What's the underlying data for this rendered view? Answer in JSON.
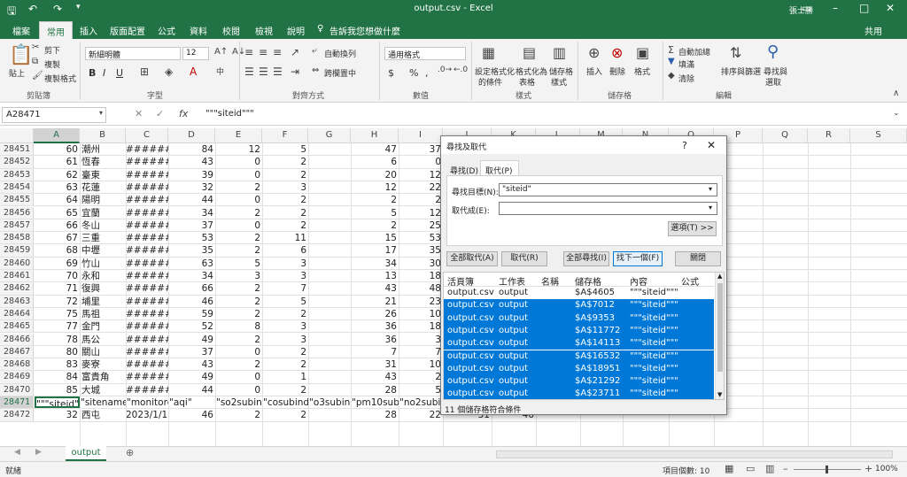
{
  "titlebar": {
    "file": "output.csv",
    "app": "Excel",
    "title": "output.csv - Excel",
    "user": "張士勝"
  },
  "tabs": [
    "檔案",
    "常用",
    "插入",
    "版面配置",
    "公式",
    "資料",
    "校閱",
    "檢視",
    "說明",
    "告訴我您想做什麼"
  ],
  "active_tab": "常用",
  "share": "共用",
  "ribbon": {
    "clipboard": {
      "paste": "貼上",
      "cut": "剪下",
      "copy": "複製",
      "format_painter": "複製格式",
      "label": "剪貼簿"
    },
    "font": {
      "name": "新細明體",
      "size": "12",
      "label": "字型",
      "bold": "B",
      "italic": "I",
      "underline": "U"
    },
    "alignment": {
      "wrap": "自動換列",
      "merge": "跨欄置中",
      "label": "對齊方式"
    },
    "number": {
      "format": "通用格式",
      "label": "數值",
      "currency": "$",
      "percent": "%",
      "comma": ","
    },
    "styles": {
      "conditional": [
        "設定格式化",
        "的條件"
      ],
      "table": [
        "格式化為",
        "表格"
      ],
      "cell": [
        "儲存格",
        "樣式"
      ],
      "label": "樣式"
    },
    "cells": {
      "insert": "插入",
      "delete": "刪除",
      "format": "格式",
      "label": "儲存格"
    },
    "editing": {
      "autosum": "自動加總",
      "fill": "填滿",
      "clear": "清除",
      "sort": [
        "排序與篩選"
      ],
      "find": [
        "尋找與",
        "選取"
      ],
      "label": "編輯"
    }
  },
  "formula_bar": {
    "name_box": "A28471",
    "content": "\"\"\"siteid\"\"\""
  },
  "columns": [
    "A",
    "B",
    "C",
    "D",
    "E",
    "F",
    "G",
    "H",
    "I",
    "J",
    "K",
    "L",
    "M",
    "N",
    "O",
    "P",
    "Q",
    "R",
    "S"
  ],
  "rows": [
    {
      "n": "28451",
      "a": "60",
      "b": "潮州",
      "c": "########",
      "d": "84",
      "e": "12",
      "f": "5",
      "h": "47",
      "i": "37"
    },
    {
      "n": "28452",
      "a": "61",
      "b": "恆春",
      "c": "########",
      "d": "43",
      "e": "0",
      "f": "2",
      "h": "6",
      "i": "0"
    },
    {
      "n": "28453",
      "a": "62",
      "b": "臺東",
      "c": "########",
      "d": "39",
      "e": "0",
      "f": "2",
      "h": "20",
      "i": "12"
    },
    {
      "n": "28454",
      "a": "63",
      "b": "花蓮",
      "c": "########",
      "d": "32",
      "e": "2",
      "f": "3",
      "h": "12",
      "i": "22"
    },
    {
      "n": "28455",
      "a": "64",
      "b": "陽明",
      "c": "########",
      "d": "44",
      "e": "0",
      "f": "2",
      "h": "2",
      "i": "2"
    },
    {
      "n": "28456",
      "a": "65",
      "b": "宜蘭",
      "c": "########",
      "d": "34",
      "e": "2",
      "f": "2",
      "h": "5",
      "i": "12"
    },
    {
      "n": "28457",
      "a": "66",
      "b": "冬山",
      "c": "########",
      "d": "37",
      "e": "0",
      "f": "2",
      "h": "2",
      "i": "25"
    },
    {
      "n": "28458",
      "a": "67",
      "b": "三重",
      "c": "########",
      "d": "53",
      "e": "2",
      "f": "11",
      "h": "15",
      "i": "53"
    },
    {
      "n": "28459",
      "a": "68",
      "b": "中壢",
      "c": "########",
      "d": "35",
      "e": "2",
      "f": "6",
      "h": "17",
      "i": "35"
    },
    {
      "n": "28460",
      "a": "69",
      "b": "竹山",
      "c": "########",
      "d": "63",
      "e": "5",
      "f": "3",
      "h": "34",
      "i": "30"
    },
    {
      "n": "28461",
      "a": "70",
      "b": "永和",
      "c": "########",
      "d": "34",
      "e": "3",
      "f": "3",
      "h": "13",
      "i": "18"
    },
    {
      "n": "28462",
      "a": "71",
      "b": "復興",
      "c": "########",
      "d": "66",
      "e": "2",
      "f": "7",
      "h": "43",
      "i": "48"
    },
    {
      "n": "28463",
      "a": "72",
      "b": "埔里",
      "c": "########",
      "d": "46",
      "e": "2",
      "f": "5",
      "h": "21",
      "i": "23"
    },
    {
      "n": "28464",
      "a": "75",
      "b": "馬祖",
      "c": "########",
      "d": "59",
      "e": "2",
      "f": "2",
      "h": "26",
      "i": "10"
    },
    {
      "n": "28465",
      "a": "77",
      "b": "金門",
      "c": "########",
      "d": "52",
      "e": "8",
      "f": "3",
      "h": "36",
      "i": "18"
    },
    {
      "n": "28466",
      "a": "78",
      "b": "馬公",
      "c": "########",
      "d": "49",
      "e": "2",
      "f": "3",
      "h": "36",
      "i": "3"
    },
    {
      "n": "28467",
      "a": "80",
      "b": "關山",
      "c": "########",
      "d": "37",
      "e": "0",
      "f": "2",
      "h": "7",
      "i": "7"
    },
    {
      "n": "28468",
      "a": "83",
      "b": "麥寮",
      "c": "########",
      "d": "43",
      "e": "2",
      "f": "2",
      "h": "31",
      "i": "10"
    },
    {
      "n": "28469",
      "a": "84",
      "b": "富貴角",
      "c": "########",
      "d": "49",
      "e": "0",
      "f": "1",
      "h": "43",
      "i": "2"
    },
    {
      "n": "28470",
      "a": "85",
      "b": "大城",
      "c": "########",
      "d": "44",
      "e": "0",
      "f": "2",
      "h": "28",
      "i": "5"
    }
  ],
  "header_row": {
    "n": "28471",
    "cells": [
      "\"\"\"siteid\"\"\"",
      "\"sitename\"",
      "\"monitorda",
      "\"aqi\"",
      "",
      "\"so2subind",
      "\"cosubinde",
      "\"o3subinde",
      "\"pm10subi",
      "\"no2subin",
      "\"o38subinc",
      "\"pm25subindex\""
    ]
  },
  "last_row": {
    "n": "28472",
    "a": "32",
    "b": "西屯",
    "c": "2023/1/1",
    "d": "46",
    "e": "2",
    "f": "2",
    "h": "28",
    "i": "22",
    "j": "31",
    "k": "46"
  },
  "sheet_tab": "output",
  "status": {
    "mode": "就緒",
    "count": "項目個數: 10",
    "zoom": "100%"
  },
  "dialog": {
    "title": "尋找及取代",
    "tabs": [
      "尋找(D)",
      "取代(P)"
    ],
    "find_label": "尋找目標(N):",
    "find_value": "\"siteid\"",
    "replace_label": "取代成(E):",
    "replace_value": "",
    "options": "選項(T) >>",
    "buttons": [
      "全部取代(A)",
      "取代(R)",
      "全部尋找(I)",
      "找下一個(F)",
      "關閉"
    ],
    "list_headers": [
      "活頁簿",
      "工作表",
      "名稱",
      "儲存格",
      "內容",
      "公式"
    ],
    "results": [
      {
        "book": "output.csv",
        "sheet": "output",
        "cell": "$A$4605",
        "value": "\"\"\"siteid\"\"\""
      },
      {
        "book": "output.csv",
        "sheet": "output",
        "cell": "$A$7012",
        "value": "\"\"\"siteid\"\"\""
      },
      {
        "book": "output.csv",
        "sheet": "output",
        "cell": "$A$9353",
        "value": "\"\"\"siteid\"\"\""
      },
      {
        "book": "output.csv",
        "sheet": "output",
        "cell": "$A$11772",
        "value": "\"\"\"siteid\"\"\""
      },
      {
        "book": "output.csv",
        "sheet": "output",
        "cell": "$A$14113",
        "value": "\"\"\"siteid\"\"\""
      },
      {
        "book": "output.csv",
        "sheet": "output",
        "cell": "$A$16532",
        "value": "\"\"\"siteid\"\"\""
      },
      {
        "book": "output.csv",
        "sheet": "output",
        "cell": "$A$18951",
        "value": "\"\"\"siteid\"\"\""
      },
      {
        "book": "output.csv",
        "sheet": "output",
        "cell": "$A$21292",
        "value": "\"\"\"siteid\"\"\""
      },
      {
        "book": "output.csv",
        "sheet": "output",
        "cell": "$A$23711",
        "value": "\"\"\"siteid\"\"\""
      }
    ],
    "footer": "11 個儲存格符合條件"
  },
  "colors": {
    "excel_green": "#217346",
    "selection": "#0078d7"
  }
}
